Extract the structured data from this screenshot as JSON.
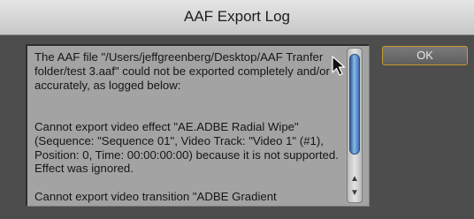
{
  "window": {
    "title": "AAF Export Log"
  },
  "log": {
    "text": "The AAF file \"/Users/jeffgreenberg/Desktop/AAF Tranfer folder/test 3.aaf\" could not be exported completely and/or accurately, as logged below:\n\n\nCannot export video effect \"AE.ADBE Radial Wipe\" (Sequence: \"Sequence 01\", Video Track: \"Video 1\" (#1), Position: 0, Time: 00:00:00:00) because it is not supported. Effect was ignored.\n\nCannot export video transition \"ADBE Gradient"
  },
  "buttons": {
    "ok_label": "OK"
  },
  "scroll": {
    "up_arrow": "▲",
    "down_arrow": "▼"
  },
  "colors": {
    "accent_border": "#c49a2b",
    "scroll_thumb": "#5b93d3"
  }
}
